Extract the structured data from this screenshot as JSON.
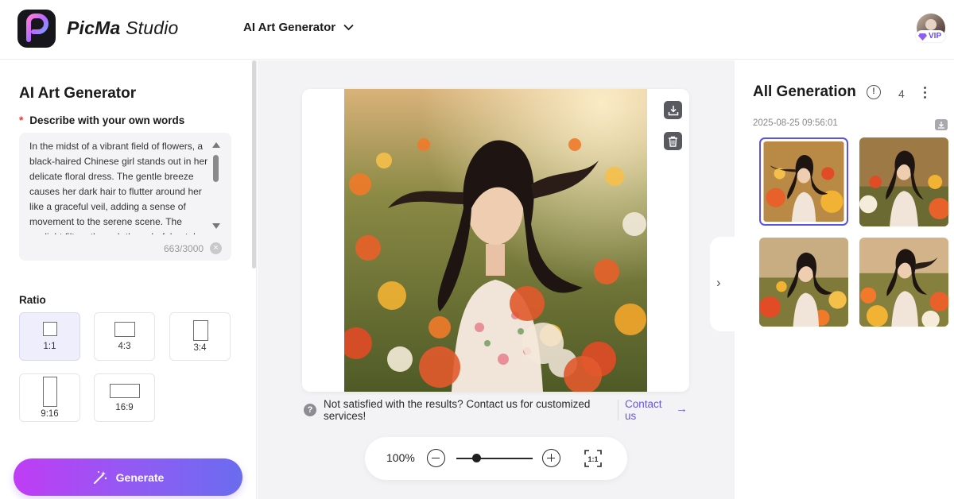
{
  "header": {
    "brand_bold": "PicMa",
    "brand_light": "Studio",
    "tool_selector": "AI Art Generator",
    "vip_label": "VIP"
  },
  "left_panel": {
    "title": "AI Art Generator",
    "prompt_required_mark": "*",
    "prompt_label": "Describe with your own words",
    "prompt_text": "In the midst of a vibrant field of flowers, a black-haired Chinese girl stands out in her delicate floral dress. The gentle breeze causes her dark hair to flutter around her like a graceful veil, adding a sense of movement to the serene scene. The sunlight filters through the colorful petals, casting a",
    "char_count": "663/3000",
    "ratio_label": "Ratio",
    "ratios": [
      {
        "label": "1:1",
        "active": true
      },
      {
        "label": "4:3",
        "active": false
      },
      {
        "label": "3:4",
        "active": false
      },
      {
        "label": "9:16",
        "active": false
      },
      {
        "label": "16:9",
        "active": false
      }
    ],
    "generate_label": "Generate"
  },
  "center": {
    "help_text": "Not satisfied with the results? Contact us for customized services!",
    "contact_label": "Contact us",
    "zoom_value": "100%",
    "zoom_slider_fraction": 0.27,
    "fit_label": "1:1"
  },
  "right_panel": {
    "title": "All Generation",
    "info_glyph": "!",
    "count": "4",
    "date": "2025-08-25 09:56:01"
  },
  "colors": {
    "accent": "#6a55e0",
    "generate_gradient_start": "#c03cf5",
    "generate_gradient_end": "#6a6cf0",
    "selected_border": "#5b52e6"
  }
}
